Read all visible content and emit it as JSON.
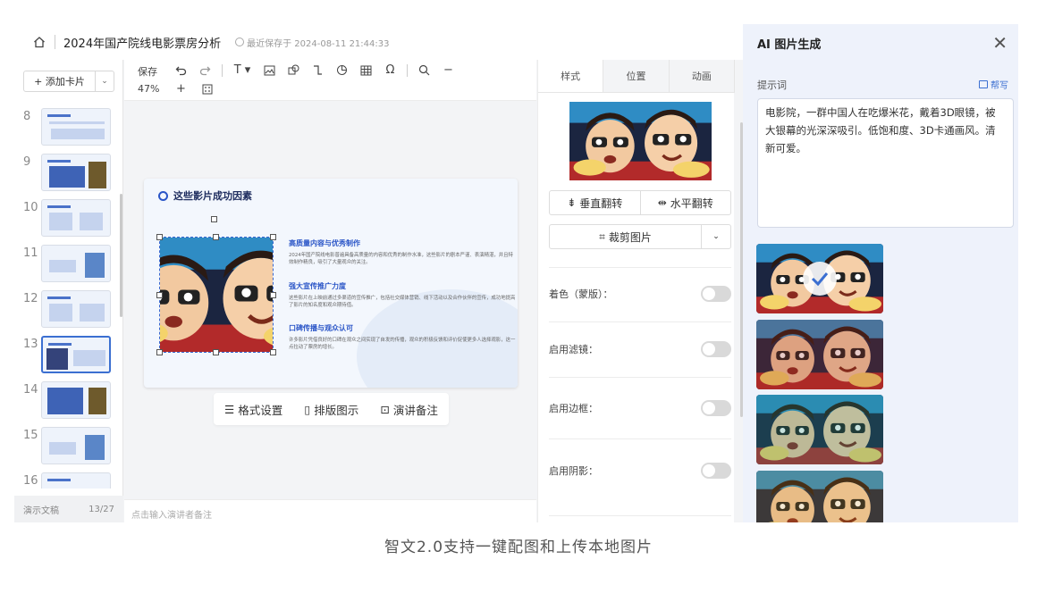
{
  "header": {
    "doc_title": "2024年国产院线电影票房分析",
    "save_status": "最近保存于 2024-08-11 21:44:33"
  },
  "left_panel": {
    "add_card_label": "+ 添加卡片",
    "slide_numbers": [
      "8",
      "9",
      "10",
      "11",
      "12",
      "13",
      "14",
      "15",
      "16"
    ],
    "active_slide": "13",
    "footer_label": "演示文稿",
    "footer_count": "13/27"
  },
  "toolbar": {
    "save_label": "保存",
    "zoom_label": "47%",
    "zoom_in": "+",
    "zoom_out": "−",
    "text_tool": "T ▾",
    "symbol_tool": "Ω"
  },
  "slide": {
    "title": "这些影片成功因素",
    "points": [
      {
        "heading": "高质量内容与优秀制作",
        "body": "2024年国产院线电影普遍具备高质量的内容和优秀的制作水准，这些影片的剧本严谨、表演精湛，并且特效制作精良，吸引了大量观众的关注。"
      },
      {
        "heading": "强大宣传推广力度",
        "body": "这些影片在上映前通过多渠道的宣传推广，包括社交媒体营销、线下活动以及合作伙伴的宣传，成功地提高了影片的知名度和观众期待值。"
      },
      {
        "heading": "口碑传播与观众认可",
        "body": "许多影片凭借良好的口碑在观众之间实现了自发的传播，观众的积极反馈和评价促使更多人选择观影，这一点拉动了票房的增长。"
      }
    ]
  },
  "floatbar": {
    "format": "格式设置",
    "layout": "排版图示",
    "notes": "演讲备注"
  },
  "notes_placeholder": "点击输入演讲者备注",
  "style_panel": {
    "tabs": [
      "样式",
      "位置",
      "动画"
    ],
    "active_tab": "样式",
    "flip_vertical": "垂直翻转",
    "flip_horizontal": "水平翻转",
    "crop": "裁剪图片",
    "options": [
      "着色（蒙版）：",
      "启用滤镜：",
      "启用边框：",
      "启用阴影："
    ]
  },
  "ai_panel": {
    "title": "AI 图片生成",
    "prompt_label": "提示词",
    "help_label": "帮写",
    "prompt_text": "电影院，一群中国人在吃爆米花，戴着3D眼镜，被大银幕的光深深吸引。低饱和度、3D卡通画风。清新可爱。"
  },
  "caption": "智文2.0支持一键配图和上传本地图片",
  "colors": {
    "accent": "#3b6fd1",
    "title_navy": "#1d2c5e",
    "panel_bg": "#eef2fb"
  }
}
